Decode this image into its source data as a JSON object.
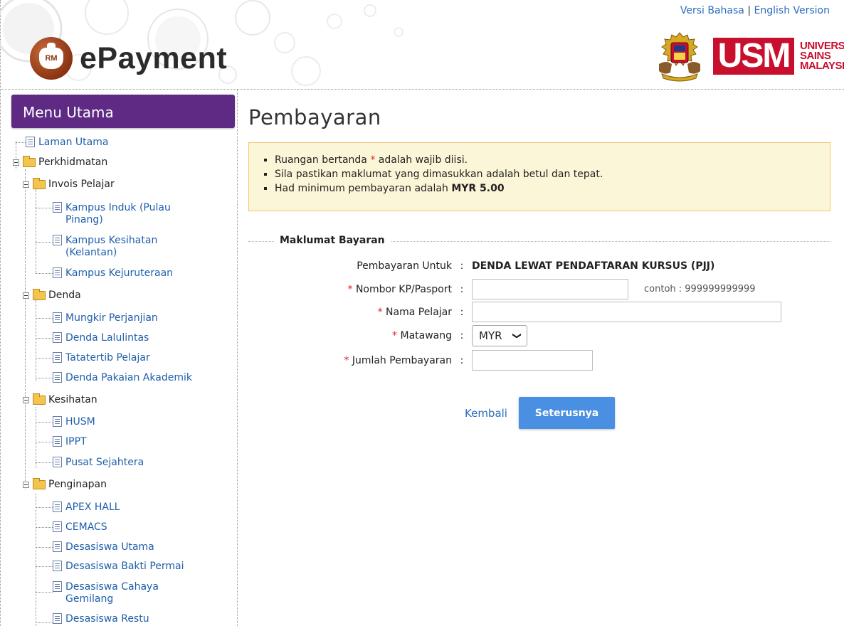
{
  "header": {
    "logo_badge": "RM",
    "logo_text": "ePayment",
    "lang_malay": "Versi Bahasa",
    "lang_sep": "|",
    "lang_english": "English Version",
    "usm_mark": "USM",
    "usm_line1": "UNIVERSITI",
    "usm_line2": "SAINS",
    "usm_line3": "MALAYSIA"
  },
  "sidebar": {
    "title": "Menu Utama",
    "items": {
      "laman_utama": "Laman Utama",
      "perkhidmatan": "Perkhidmatan",
      "invois_pelajar": "Invois Pelajar",
      "kampus_induk": "Kampus Induk (Pulau",
      "kampus_induk_2": "Pinang)",
      "kampus_kesihatan": "Kampus Kesihatan",
      "kampus_kesihatan_2": "(Kelantan)",
      "kampus_kejuruteraan": "Kampus Kejuruteraan",
      "denda": "Denda",
      "mungkir": "Mungkir Perjanjian",
      "lalulintas": "Denda Lalulintas",
      "tatatertib": "Tatatertib Pelajar",
      "pakaian": "Denda Pakaian Akademik",
      "kesihatan": "Kesihatan",
      "husm": "HUSM",
      "ippt": "IPPT",
      "sejahtera": "Pusat Sejahtera",
      "penginapan": "Penginapan",
      "apex": "APEX HALL",
      "cemacs": "CEMACS",
      "desasiswa_utama": "Desasiswa Utama",
      "bakti_permai": "Desasiswa Bakti Permai",
      "cahaya_gemilang": "Desasiswa Cahaya",
      "cahaya_gemilang_2": "Gemilang",
      "restu": "Desasiswa Restu"
    }
  },
  "main": {
    "title": "Pembayaran",
    "notice": {
      "line1_pre": "Ruangan bertanda",
      "line1_star": "*",
      "line1_post": "adalah wajib diisi.",
      "line2": "Sila pastikan maklumat yang dimasukkan adalah betul dan tepat.",
      "line3_pre": "Had minimum pembayaran adalah",
      "line3_amount": "MYR 5.00"
    },
    "section_legend": "Maklumat Bayaran",
    "form": {
      "star": "*",
      "colon": ":",
      "untuk_label": "Pembayaran Untuk",
      "untuk_value": "DENDA LEWAT PENDAFTARAN KURSUS (PJJ)",
      "kp_label": "Nombor KP/Pasport",
      "kp_value": "",
      "kp_hint": "contoh : 999999999999",
      "nama_label": "Nama Pelajar",
      "nama_value": "",
      "matawang_label": "Matawang",
      "matawang_value": "MYR",
      "jumlah_label": "Jumlah Pembayaran",
      "jumlah_value": ""
    },
    "buttons": {
      "back": "Kembali",
      "next": "Seterusnya"
    }
  },
  "colors": {
    "menu_header_bg": "#5e2a84",
    "link": "#1f5faa",
    "notice_bg": "#fcf6d8",
    "notice_border": "#f0c36d",
    "required": "#e0262b",
    "primary_button": "#4a90e2",
    "usm_red": "#c8102e"
  }
}
